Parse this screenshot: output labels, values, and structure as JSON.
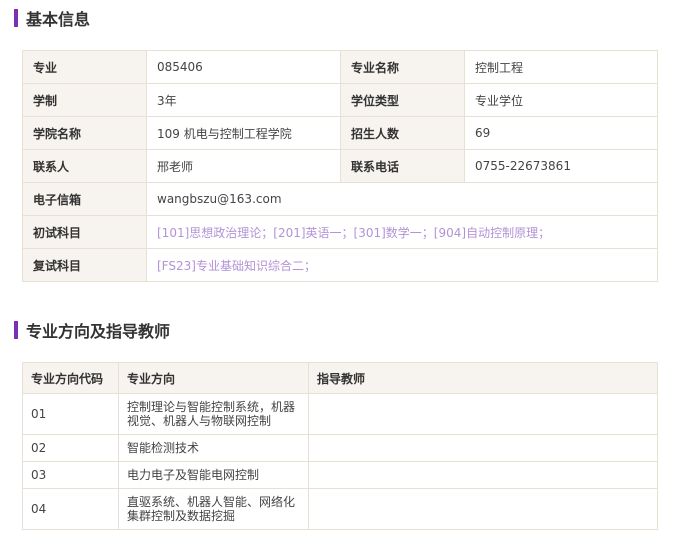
{
  "basic": {
    "title": "基本信息",
    "major_label": "专业",
    "major_value": "085406",
    "major_name_label": "专业名称",
    "major_name_value": "控制工程",
    "duration_label": "学制",
    "duration_value": "3年",
    "degree_type_label": "学位类型",
    "degree_type_value": "专业学位",
    "college_label": "学院名称",
    "college_value": "109 机电与控制工程学院",
    "enroll_label": "招生人数",
    "enroll_value": "69",
    "contact_label": "联系人",
    "contact_value": "邢老师",
    "phone_label": "联系电话",
    "phone_value": "0755-22673861",
    "email_label": "电子信箱",
    "email_value": "wangbszu@163.com",
    "initial_label": "初试科目",
    "initial_value": "[101]思想政治理论；[201]英语一；[301]数学一；[904]自动控制原理；",
    "retest_label": "复试科目",
    "retest_value": "[FS23]专业基础知识综合二；",
    "link_color": "#b392d6"
  },
  "directions": {
    "title": "专业方向及指导教师",
    "headers": [
      "专业方向代码",
      "专业方向",
      "指导教师"
    ],
    "rows": [
      {
        "code": "01",
        "name": "控制理论与智能控制系统，机器视觉、机器人与物联网控制",
        "teacher": ""
      },
      {
        "code": "02",
        "name": "智能检测技术",
        "teacher": ""
      },
      {
        "code": "03",
        "name": "电力电子及智能电网控制",
        "teacher": ""
      },
      {
        "code": "04",
        "name": "直驱系统、机器人智能、网络化集群控制及数据挖掘",
        "teacher": ""
      }
    ]
  },
  "colors": {
    "accent": "#7b2fb5",
    "label_bg": "#f7f4ef",
    "border": "#e8e0d4"
  }
}
